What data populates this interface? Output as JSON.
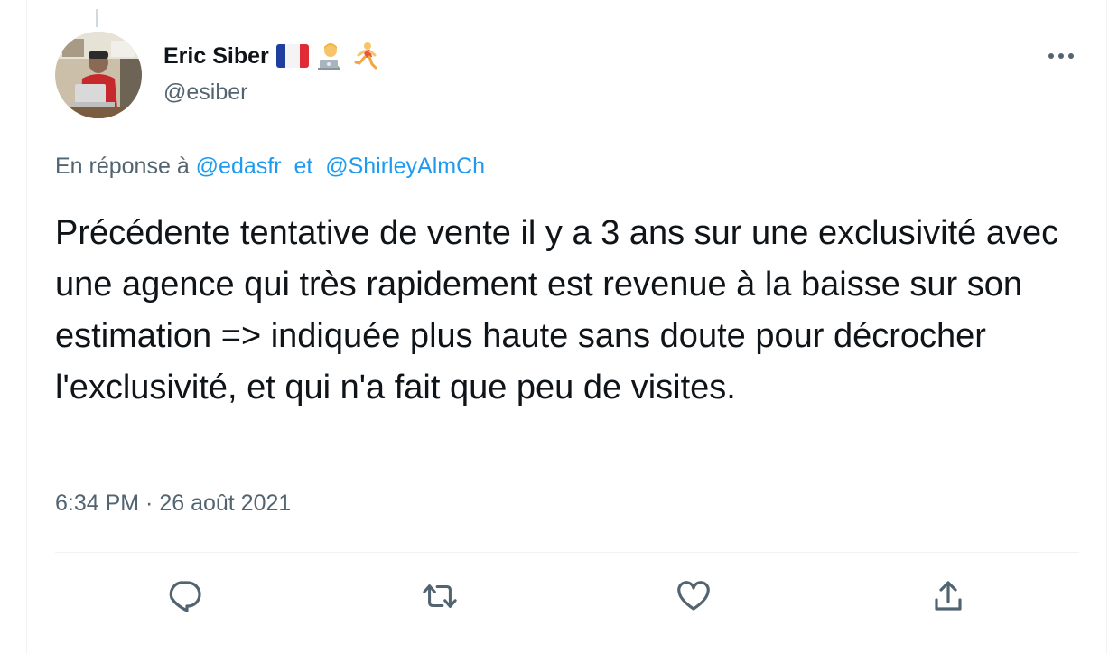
{
  "tweet": {
    "author": {
      "display_name": "Eric Siber",
      "handle": "@esiber",
      "avatar_icon": "profile-photo"
    },
    "reply_context": {
      "prefix": "En réponse à",
      "mention_1": "@edasfr",
      "conjunction": "et",
      "mention_2": "@ShirleyAlmCh"
    },
    "text": "Précédente tentative de vente il y a 3 ans sur une exclusivité avec une agence qui très rapidement est revenue à la baisse sur son estimation => indiquée plus haute sans doute pour décrocher l'exclusivité, et qui n'a fait que peu de visites.",
    "timestamp": "6:34 PM · 26 août 2021",
    "actions": {
      "reply_icon": "reply-icon",
      "retweet_icon": "retweet-icon",
      "like_icon": "heart-icon",
      "share_icon": "share-icon"
    }
  },
  "colors": {
    "text": "#0f1419",
    "secondary": "#536471",
    "link": "#1d9bf0",
    "border": "#eff3f4"
  }
}
